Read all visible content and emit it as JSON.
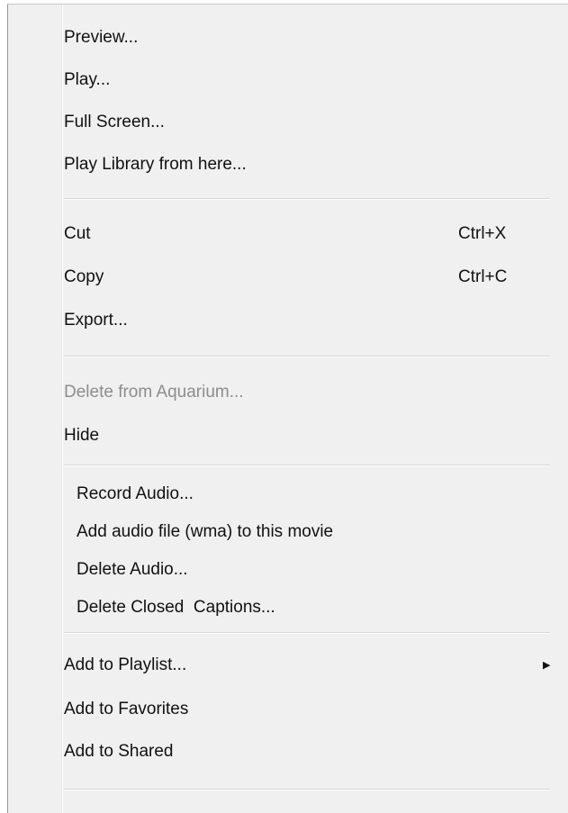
{
  "menu": {
    "preview": "Preview...",
    "play": "Play...",
    "full_screen": "Full Screen...",
    "play_library": "Play Library from here...",
    "cut": "Cut",
    "cut_shortcut": "Ctrl+X",
    "copy": "Copy",
    "copy_shortcut": "Ctrl+C",
    "export": "Export...",
    "delete_from_aquarium": "Delete from Aquarium...",
    "hide": "Hide",
    "record_audio": "Record Audio...",
    "add_audio_file": "Add audio file (wma) to this movie",
    "delete_audio": "Delete Audio...",
    "delete_closed_captions": "Delete Closed  Captions...",
    "add_to_playlist": "Add to Playlist...",
    "submenu_arrow": "▶",
    "add_to_favorites": "Add to Favorites",
    "add_to_shared": "Add to Shared"
  },
  "icons": {
    "submenu": "chevron-right-icon"
  },
  "colors": {
    "menu_background": "#f0f0f0",
    "disabled_text": "#8d8d8d",
    "text": "#111111"
  }
}
